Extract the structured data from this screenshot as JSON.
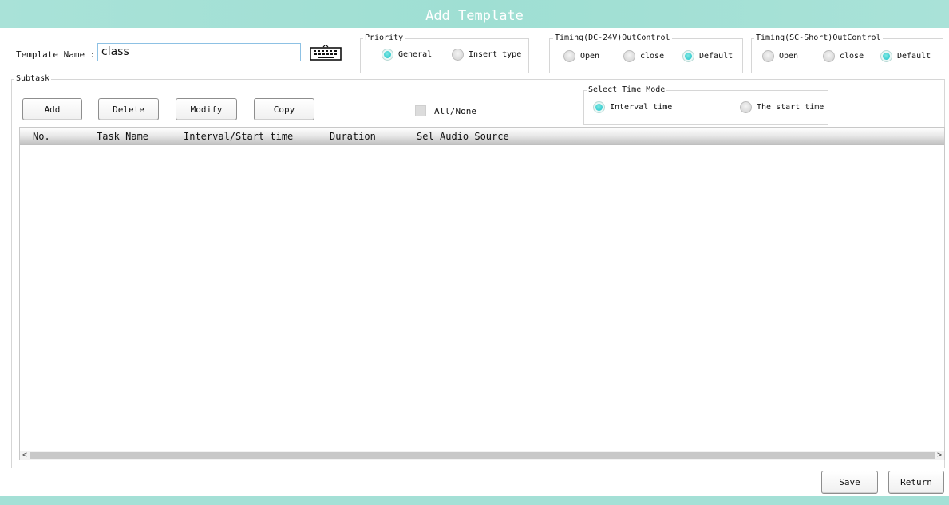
{
  "window": {
    "title": "Add Template"
  },
  "template_name": {
    "label": "Template Name :",
    "value": "class",
    "keyboard_icon": "keyboard-icon"
  },
  "priority": {
    "title": "Priority",
    "options": [
      {
        "label": "General",
        "checked": true
      },
      {
        "label": "Insert type",
        "checked": false
      }
    ]
  },
  "timing_dc": {
    "title": "Timing(DC-24V)OutControl",
    "options": [
      {
        "label": "Open",
        "checked": false
      },
      {
        "label": "close",
        "checked": false
      },
      {
        "label": "Default",
        "checked": true
      }
    ]
  },
  "timing_sc": {
    "title": "Timing(SC-Short)OutControl",
    "options": [
      {
        "label": "Open",
        "checked": false
      },
      {
        "label": "close",
        "checked": false
      },
      {
        "label": "Default",
        "checked": true
      }
    ]
  },
  "subtask": {
    "title": "Subtask",
    "buttons": {
      "add": "Add",
      "delete": "Delete",
      "modify": "Modify",
      "copy": "Copy"
    },
    "all_none": "All/None"
  },
  "time_mode": {
    "title": "Select Time Mode",
    "options": [
      {
        "label": "Interval time",
        "checked": true
      },
      {
        "label": "The start time",
        "checked": false
      }
    ]
  },
  "table": {
    "columns": [
      "No.",
      "Task Name",
      "Interval/Start time",
      "Duration",
      "Sel",
      "Audio Source"
    ],
    "rows": []
  },
  "scrollbar": {
    "left_arrow": "<",
    "right_arrow": ">"
  },
  "footer": {
    "save": "Save",
    "return": "Return"
  },
  "colors": {
    "title_bar": "#a4e0d6",
    "radio_checked": "#18c1c9",
    "input_border": "#8dc1e4"
  }
}
